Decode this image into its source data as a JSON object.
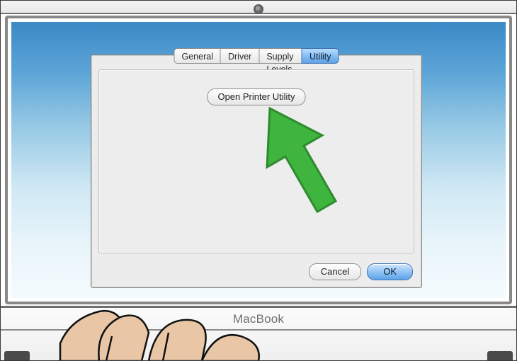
{
  "tabs": {
    "general": "General",
    "driver": "Driver",
    "supply": "Supply Levels",
    "utility": "Utility",
    "active": "utility"
  },
  "buttons": {
    "open_utility": "Open Printer Utility",
    "cancel": "Cancel",
    "ok": "OK"
  },
  "device": {
    "brand": "MacBook"
  },
  "colors": {
    "arrow": "#3fb43f"
  }
}
